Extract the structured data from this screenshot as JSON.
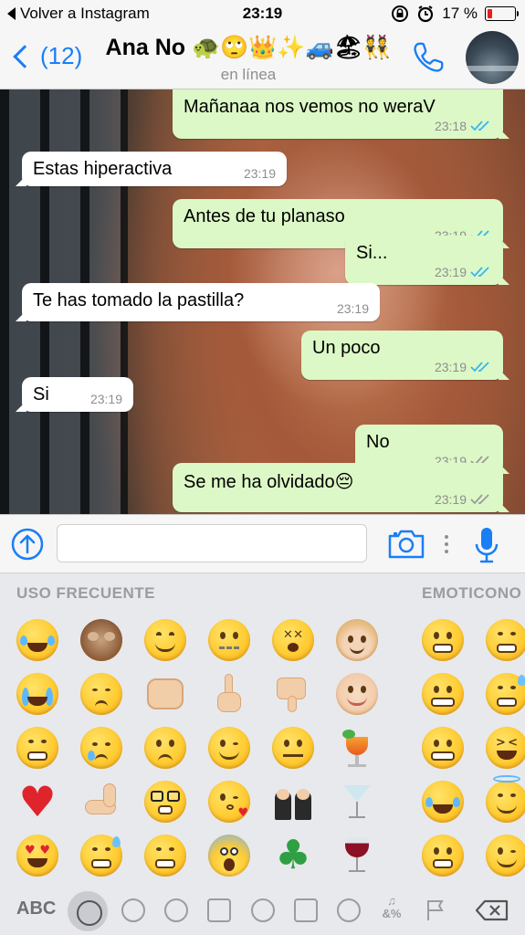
{
  "status_bar": {
    "back_app": "Volver a Instagram",
    "time": "23:19",
    "battery": "17 %",
    "battery_level": 0.17
  },
  "header": {
    "back_count": "(12)",
    "contact_name": "Ana No 🐢🙄👑✨🚙🏖👯",
    "status": "en línea"
  },
  "messages": [
    {
      "text": "Mañanaa nos vemos no weraV",
      "time": "23:18",
      "direction": "out",
      "read": true
    },
    {
      "text": "Estas hiperactiva",
      "time": "23:19",
      "direction": "in"
    },
    {
      "text": "Antes de tu planaso",
      "time": "23:19",
      "direction": "out",
      "read": true
    },
    {
      "text": "Si...",
      "time": "23:19",
      "direction": "out",
      "read": true
    },
    {
      "text": "Te has tomado la pastilla?",
      "time": "23:19",
      "direction": "in"
    },
    {
      "text": "Un poco",
      "time": "23:19",
      "direction": "out",
      "read": true
    },
    {
      "text": "Si",
      "time": "23:19",
      "direction": "in"
    },
    {
      "text": "No",
      "time": "23:19",
      "direction": "out",
      "read": false
    },
    {
      "text": "Se me ha olvidado😔",
      "time": "23:19",
      "direction": "out",
      "read": false
    }
  ],
  "input": {
    "placeholder": "",
    "value": ""
  },
  "keyboard": {
    "section_frequent": "USO FRECUENTE",
    "section_emoticons": "EMOTICONO",
    "abc_label": "ABC",
    "accent_blue": "#1a7ef5",
    "categories": [
      "clock-icon",
      "smiley-icon",
      "animal-icon",
      "food-icon",
      "ball-icon",
      "building-icon",
      "bulb-icon",
      "symbols-icon",
      "flag-icon"
    ],
    "symbols_label": "&%",
    "symbols_label_top": "♫"
  },
  "colors": {
    "accent": "#1a7ef5",
    "bubble_out": "#dcf8c6",
    "bubble_in": "#ffffff",
    "read_ticks": "#34b7f1",
    "unread_ticks": "#9a9a9a",
    "battery_low": "#e8201a"
  }
}
